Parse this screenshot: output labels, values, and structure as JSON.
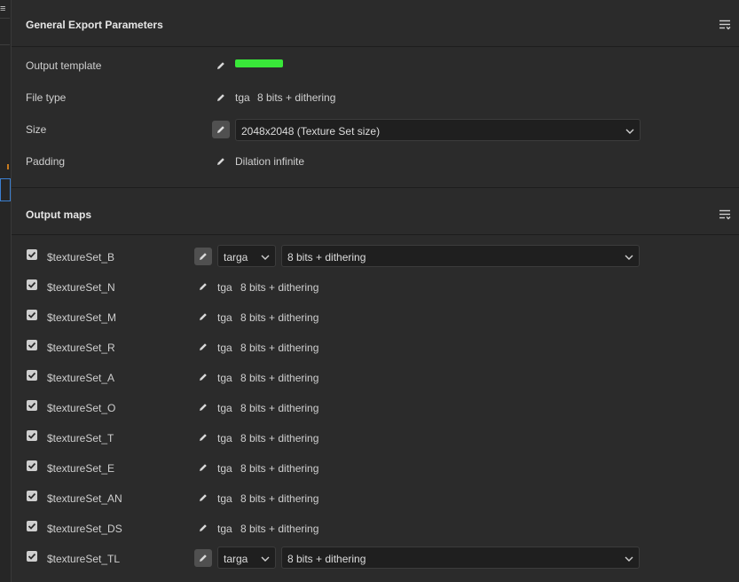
{
  "colors": {
    "background": "#2b2b2b",
    "text": "#cfcfcf",
    "redaction": "#39e739"
  },
  "general": {
    "title": "General Export Parameters",
    "rows": [
      {
        "label": "Output template",
        "value": ""
      },
      {
        "label": "File type",
        "format": "tga",
        "bits": "8 bits + dithering"
      },
      {
        "label": "Size",
        "selected": "2048x2048 (Texture Set size)"
      },
      {
        "label": "Padding",
        "value": "Dilation infinite"
      }
    ]
  },
  "output_maps": {
    "title": "Output maps",
    "items": [
      {
        "name": "$textureSet_B",
        "format": "targa",
        "bits": "8 bits + dithering",
        "checked": true,
        "expanded": true
      },
      {
        "name": "$textureSet_N",
        "format": "tga",
        "bits": "8 bits + dithering",
        "checked": true
      },
      {
        "name": "$textureSet_M",
        "format": "tga",
        "bits": "8 bits + dithering",
        "checked": true
      },
      {
        "name": "$textureSet_R",
        "format": "tga",
        "bits": "8 bits + dithering",
        "checked": true
      },
      {
        "name": "$textureSet_A",
        "format": "tga",
        "bits": "8 bits + dithering",
        "checked": true
      },
      {
        "name": "$textureSet_O",
        "format": "tga",
        "bits": "8 bits + dithering",
        "checked": true
      },
      {
        "name": "$textureSet_T",
        "format": "tga",
        "bits": "8 bits + dithering",
        "checked": true
      },
      {
        "name": "$textureSet_E",
        "format": "tga",
        "bits": "8 bits + dithering",
        "checked": true
      },
      {
        "name": "$textureSet_AN",
        "format": "tga",
        "bits": "8 bits + dithering",
        "checked": true
      },
      {
        "name": "$textureSet_DS",
        "format": "tga",
        "bits": "8 bits + dithering",
        "checked": true
      },
      {
        "name": "$textureSet_TL",
        "format": "targa",
        "bits": "8 bits + dithering",
        "checked": true,
        "expanded": true
      }
    ]
  }
}
